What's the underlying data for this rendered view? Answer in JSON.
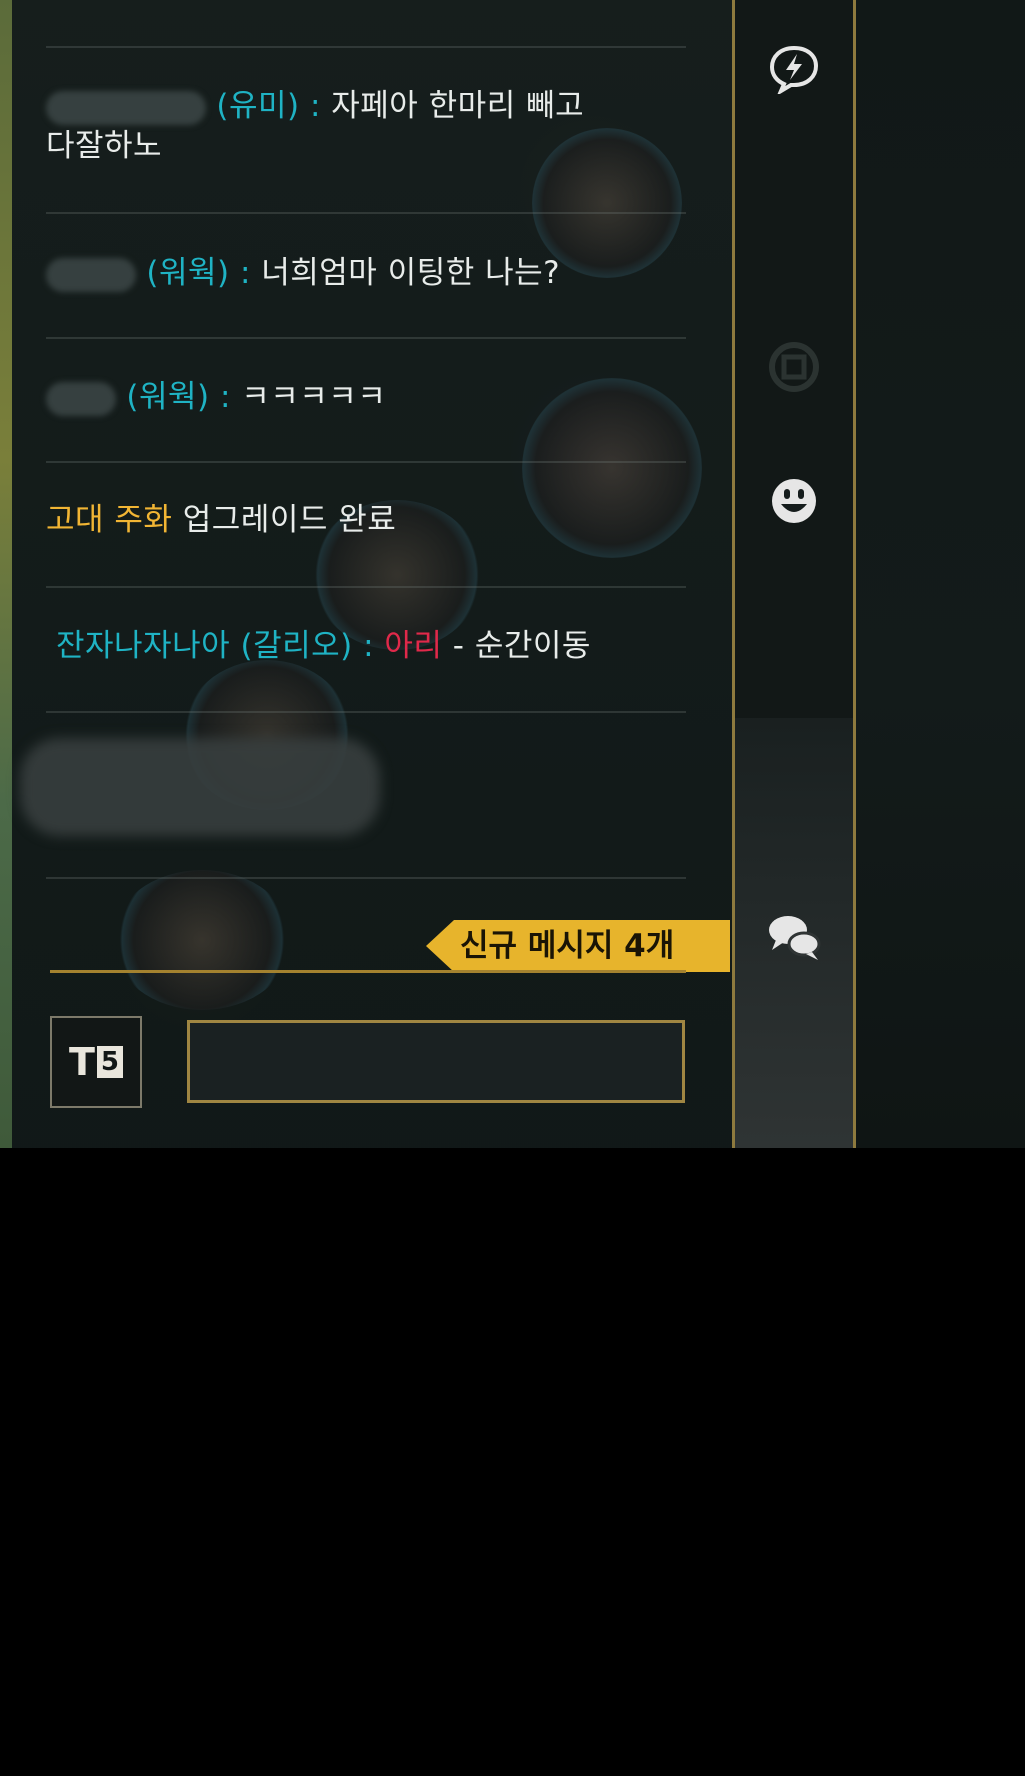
{
  "chat": {
    "messages": [
      {
        "name": "(유미)",
        "sep": " : ",
        "text": "자페아 한마리 빼고",
        "text2": "다잘하노"
      },
      {
        "name": "(워웍)",
        "sep": " : ",
        "text": "너희엄마 이팅한 나는?"
      },
      {
        "name": "(워웍)",
        "sep": " : ",
        "text": "ㅋㅋㅋㅋㅋ"
      },
      {
        "highlight": "고대 주화",
        "text": " 업그레이드 완료"
      },
      {
        "name": "잔자나자나아 (갈리오)",
        "sep": " : ",
        "champion": "아리",
        "dash": " - ",
        "spell": "순간이동"
      }
    ],
    "new_messages_label": "신규 메시지 4개",
    "channel_badge": {
      "letter": "T",
      "number": "5"
    },
    "input": {
      "value": ""
    }
  },
  "side_icons": [
    "ping-icon",
    "ward-icon",
    "emoji-icon",
    "chat-bubbles-icon"
  ],
  "colors": {
    "name": "#1fb3c4",
    "gold": "#f1b534",
    "champion": "#e0294a",
    "banner": "#e7b42c"
  }
}
